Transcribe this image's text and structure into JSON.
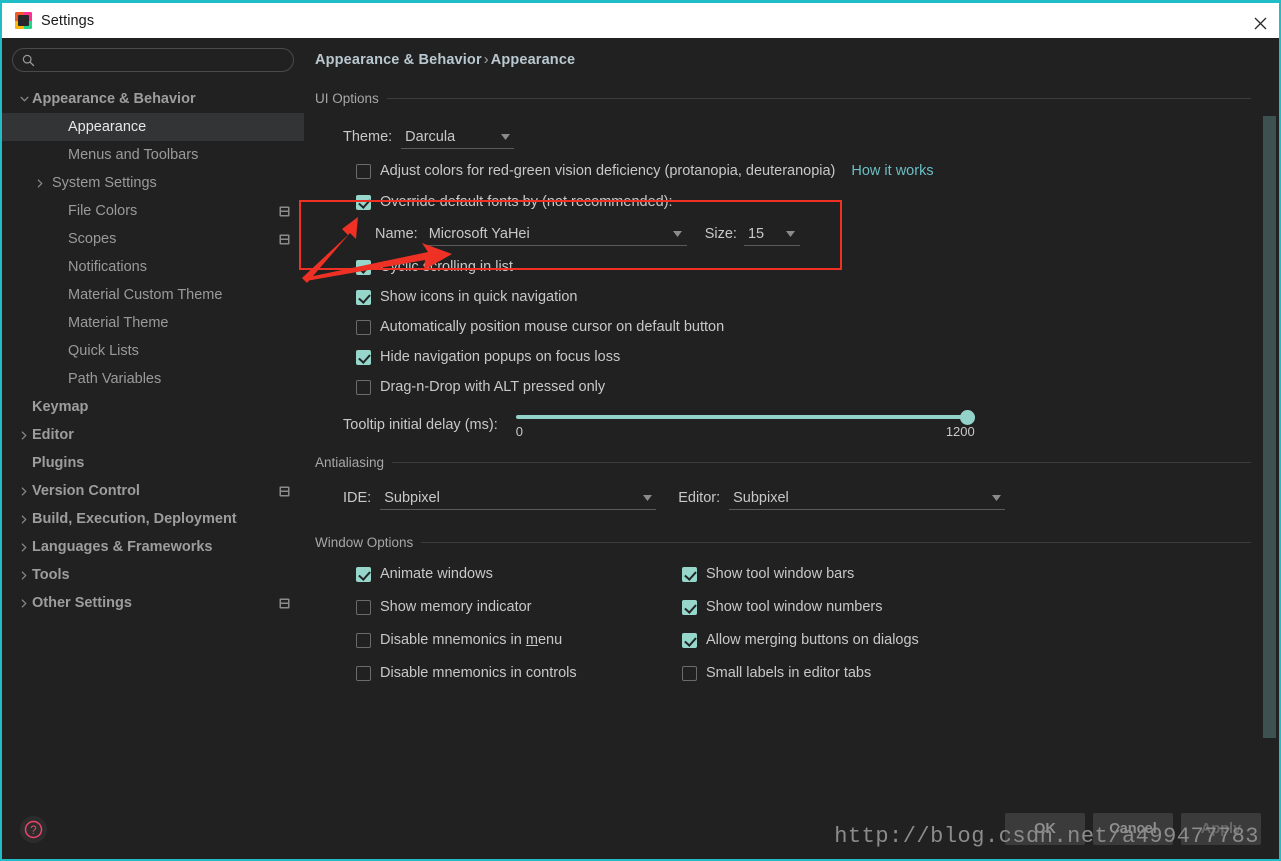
{
  "window": {
    "title": "Settings",
    "logo_icon": "intellij-idea-logo",
    "close_icon": "close-icon",
    "accent_color": "#21bdc6"
  },
  "search": {
    "placeholder": "",
    "value": "",
    "icon": "search-icon"
  },
  "sidebar": {
    "items": [
      {
        "label": "Appearance & Behavior",
        "level": 0,
        "arrow": "chevron-down-icon",
        "selected": false,
        "bold": true,
        "badge": false
      },
      {
        "label": "Appearance",
        "level": 1,
        "arrow": "",
        "selected": true,
        "bold": false,
        "badge": false
      },
      {
        "label": "Menus and Toolbars",
        "level": 1,
        "arrow": "",
        "selected": false,
        "bold": false,
        "badge": false
      },
      {
        "label": "System Settings",
        "level": 1,
        "arrow": "chevron-right-icon",
        "selected": false,
        "bold": false,
        "badge": false
      },
      {
        "label": "File Colors",
        "level": 1,
        "arrow": "",
        "selected": false,
        "bold": false,
        "badge": true
      },
      {
        "label": "Scopes",
        "level": 1,
        "arrow": "",
        "selected": false,
        "bold": false,
        "badge": true
      },
      {
        "label": "Notifications",
        "level": 1,
        "arrow": "",
        "selected": false,
        "bold": false,
        "badge": false
      },
      {
        "label": "Material Custom Theme",
        "level": 1,
        "arrow": "",
        "selected": false,
        "bold": false,
        "badge": false
      },
      {
        "label": "Material Theme",
        "level": 1,
        "arrow": "",
        "selected": false,
        "bold": false,
        "badge": false
      },
      {
        "label": "Quick Lists",
        "level": 1,
        "arrow": "",
        "selected": false,
        "bold": false,
        "badge": false
      },
      {
        "label": "Path Variables",
        "level": 1,
        "arrow": "",
        "selected": false,
        "bold": false,
        "badge": false
      },
      {
        "label": "Keymap",
        "level": 0,
        "arrow": "",
        "selected": false,
        "bold": true,
        "badge": false
      },
      {
        "label": "Editor",
        "level": 0,
        "arrow": "chevron-right-icon",
        "selected": false,
        "bold": true,
        "badge": false
      },
      {
        "label": "Plugins",
        "level": 0,
        "arrow": "",
        "selected": false,
        "bold": true,
        "badge": false
      },
      {
        "label": "Version Control",
        "level": 0,
        "arrow": "chevron-right-icon",
        "selected": false,
        "bold": true,
        "badge": true
      },
      {
        "label": "Build, Execution, Deployment",
        "level": 0,
        "arrow": "chevron-right-icon",
        "selected": false,
        "bold": true,
        "badge": false
      },
      {
        "label": "Languages & Frameworks",
        "level": 0,
        "arrow": "chevron-right-icon",
        "selected": false,
        "bold": true,
        "badge": false
      },
      {
        "label": "Tools",
        "level": 0,
        "arrow": "chevron-right-icon",
        "selected": false,
        "bold": true,
        "badge": false
      },
      {
        "label": "Other Settings",
        "level": 0,
        "arrow": "chevron-right-icon",
        "selected": false,
        "bold": true,
        "badge": true
      }
    ]
  },
  "breadcrumb": {
    "parent": "Appearance & Behavior",
    "separator": "›",
    "current": "Appearance"
  },
  "ui_options": {
    "group_title": "UI Options",
    "theme_label": "Theme:",
    "theme_value": "Darcula",
    "colorblind": {
      "label": "Adjust colors for red-green vision deficiency (protanopia, deuteranopia)",
      "checked": false
    },
    "how_it_works_link": "How it works",
    "override_fonts": {
      "label": "Override default fonts by (not recommended):",
      "checked": true
    },
    "font_name_label": "Name:",
    "font_name_value": "Microsoft YaHei",
    "font_size_label": "Size:",
    "font_size_value": "15",
    "checkboxes": [
      {
        "label": "Cyclic scrolling in list",
        "checked": true
      },
      {
        "label": "Show icons in quick navigation",
        "checked": true
      },
      {
        "label": "Automatically position mouse cursor on default button",
        "checked": false
      },
      {
        "label": "Hide navigation popups on focus loss",
        "checked": true
      },
      {
        "label": "Drag-n-Drop with ALT pressed only",
        "checked": false
      }
    ],
    "tooltip_delay": {
      "label": "Tooltip initial delay (ms):",
      "min": "0",
      "max": "1200",
      "value": "1200"
    }
  },
  "antialiasing": {
    "group_title": "Antialiasing",
    "ide_label": "IDE:",
    "ide_value": "Subpixel",
    "editor_label": "Editor:",
    "editor_value": "Subpixel"
  },
  "window_options": {
    "group_title": "Window Options",
    "left_column": [
      {
        "label": "Animate windows",
        "checked": true,
        "mnemonic": ""
      },
      {
        "label": "Show memory indicator",
        "checked": false,
        "mnemonic": ""
      },
      {
        "label": "Disable mnemonics in menu",
        "checked": false,
        "mnemonic": "m"
      },
      {
        "label": "Disable mnemonics in controls",
        "checked": false,
        "mnemonic": ""
      }
    ],
    "right_column": [
      {
        "label": "Show tool window bars",
        "checked": true,
        "mnemonic": ""
      },
      {
        "label": "Show tool window numbers",
        "checked": true,
        "mnemonic": ""
      },
      {
        "label": "Allow merging buttons on dialogs",
        "checked": true,
        "mnemonic": ""
      },
      {
        "label": "Small labels in editor tabs",
        "checked": false,
        "mnemonic": ""
      }
    ]
  },
  "footer": {
    "help_icon": "help-question-icon",
    "ok_label": "OK",
    "cancel_label": "Cancel",
    "apply_label": "Apply"
  },
  "annotations": {
    "highlight_color": "#ee3124",
    "arrow_color": "#ee3124",
    "watermark": "http://blog.csdn.net/a499477783"
  }
}
